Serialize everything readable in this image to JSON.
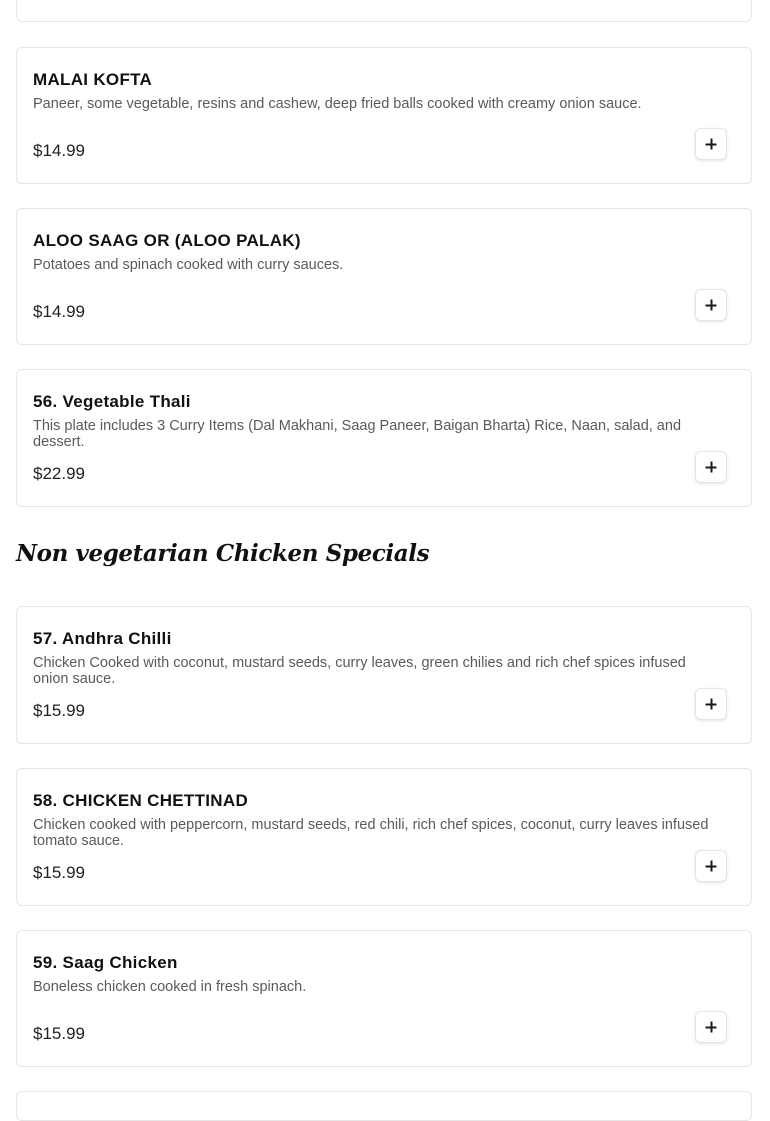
{
  "section": {
    "heading": "Non vegetarian Chicken Specials"
  },
  "items": [
    {
      "title": "MALAI KOFTA",
      "description": "Paneer, some vegetable, resins and cashew, deep fried balls cooked with creamy onion sauce.",
      "price": "$14.99"
    },
    {
      "title": "ALOO SAAG OR (ALOO PALAK)",
      "description": "Potatoes and spinach cooked with curry sauces.",
      "price": "$14.99"
    },
    {
      "title": "56. Vegetable Thali",
      "description": "This plate includes 3 Curry Items (Dal Makhani, Saag Paneer, Baigan Bharta) Rice, Naan, salad, and dessert.",
      "price": "$22.99"
    },
    {
      "title": "57. Andhra Chilli",
      "description": "Chicken Cooked with coconut, mustard seeds, curry leaves, green chilies and rich chef spices infused onion sauce.",
      "price": "$15.99"
    },
    {
      "title": "58. CHICKEN CHETTINAD",
      "description": "Chicken cooked with peppercorn, mustard seeds, red chili, rich chef spices, coconut, curry leaves infused tomato sauce.",
      "price": "$15.99"
    },
    {
      "title": "59. Saag Chicken",
      "description": "Boneless chicken cooked in fresh spinach.",
      "price": "$15.99"
    }
  ]
}
